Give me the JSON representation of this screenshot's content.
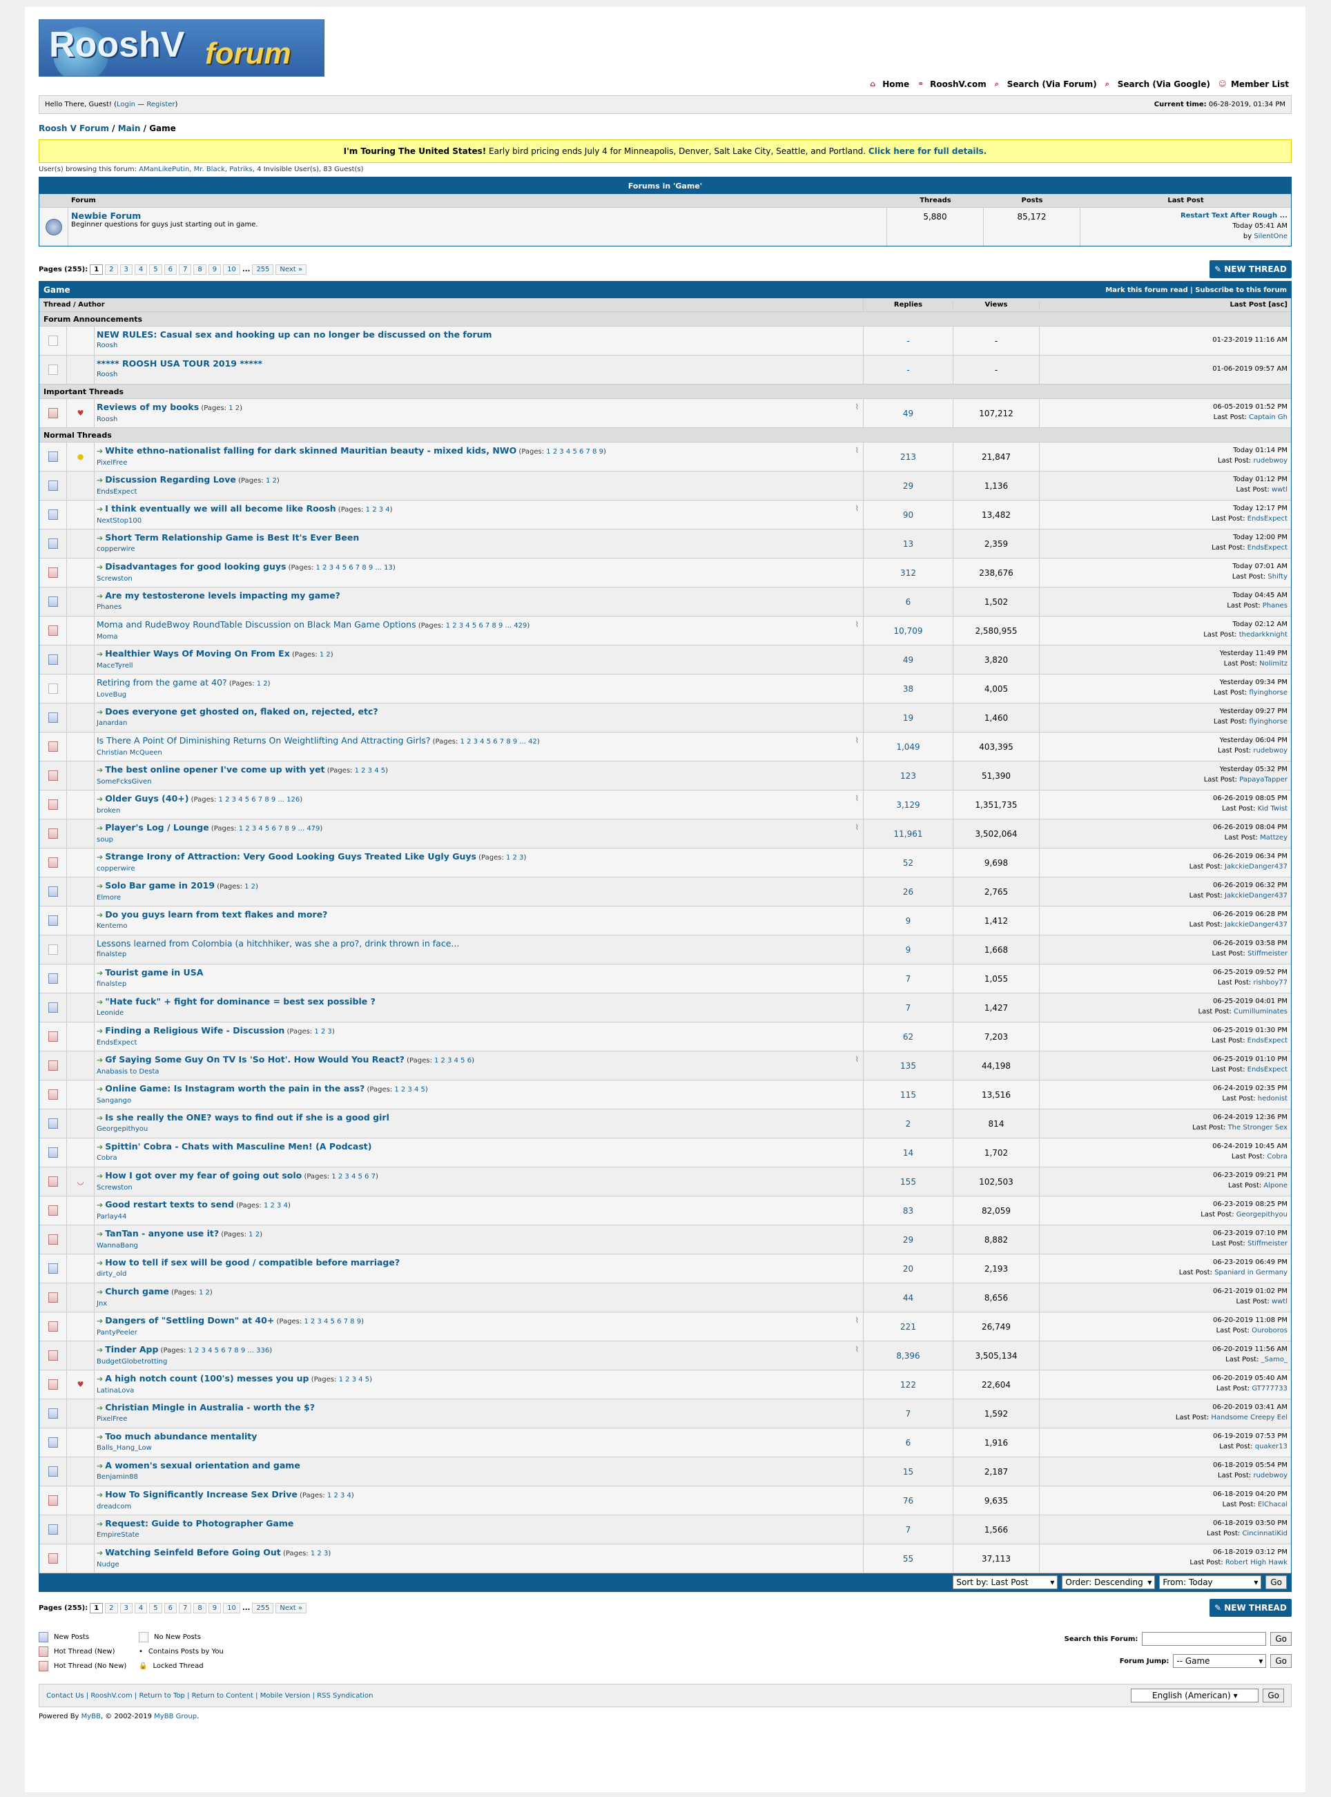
{
  "logo": {
    "text1": "RooshV",
    "text2": "forum"
  },
  "toplinks": [
    {
      "icon": "home-icon",
      "label": "Home"
    },
    {
      "icon": "link-icon",
      "label": "RooshV.com"
    },
    {
      "icon": "search-icon",
      "label": "Search (Via Forum)"
    },
    {
      "icon": "search-icon",
      "label": "Search (Via Google)"
    },
    {
      "icon": "members-icon",
      "label": "Member List"
    }
  ],
  "welcome": {
    "prefix": "Hello There, Guest! (",
    "login": "Login",
    "sep": " — ",
    "register": "Register",
    "suffix": ")",
    "time_label": "Current time:",
    "time": "06-28-2019, 01:34 PM"
  },
  "breadcrumb": [
    "Roosh V Forum",
    "Main",
    "Game"
  ],
  "banner": {
    "bold": "I'm Touring The United States!",
    "text": " Early bird pricing ends July 4 for Minneapolis, Denver, Salt Lake City, Seattle, and Portland. ",
    "link": "Click here for full details."
  },
  "browsing": {
    "prefix": "User(s) browsing this forum: ",
    "users": "AManLikePutin, Mr. Black, Patriks",
    "suffix": ", 4 Invisible User(s), 83 Guest(s)"
  },
  "subforums": {
    "title": "Forums in 'Game'",
    "headers": [
      "Forum",
      "Threads",
      "Posts",
      "Last Post"
    ],
    "rows": [
      {
        "name": "Newbie Forum",
        "desc": "Beginner questions for guys just starting out in game.",
        "threads": "5,880",
        "posts": "85,172",
        "last_title": "Restart Text After Rough ...",
        "last_time": "Today 05:41 AM",
        "last_by_prefix": "by ",
        "last_by": "SilentOne"
      }
    ]
  },
  "pagination": {
    "label": "Pages (255):",
    "pages": [
      "1",
      "2",
      "3",
      "4",
      "5",
      "6",
      "7",
      "8",
      "9",
      "10"
    ],
    "ellipsis": "...",
    "last": "255",
    "next": "Next »"
  },
  "new_thread_label": "NEW THREAD",
  "threadlist": {
    "title": "Game",
    "actions": "Mark this forum read | Subscribe to this forum",
    "headers": {
      "thread": "Thread / Author",
      "replies": "Replies",
      "views": "Views",
      "lastpost": "Last Post [asc]"
    },
    "sections": {
      "announcements": "Forum Announcements",
      "important": "Important Threads",
      "normal": "Normal Threads"
    },
    "lastpost_prefix": "Last Post: ",
    "pages_prefix": "(Pages: ",
    "pages_suffix": ")"
  },
  "announcements": [
    {
      "title": "NEW RULES: Casual sex and hooking up can no longer be discussed on the forum",
      "author": "Roosh",
      "replies": "-",
      "views": "-",
      "time": "01-23-2019 11:16 AM"
    },
    {
      "title": "***** ROOSH USA TOUR 2019 *****",
      "author": "Roosh",
      "replies": "-",
      "views": "-",
      "time": "01-06-2019 09:57 AM"
    }
  ],
  "important": [
    {
      "title": "Reviews of my books",
      "pages": "1 2",
      "author": "Roosh",
      "replies": "49",
      "views": "107,212",
      "time": "06-05-2019 01:52 PM",
      "lastby": "Captain Gh",
      "icon": "heart-icon",
      "clip": true,
      "fold": "hot"
    }
  ],
  "threads": [
    {
      "title": "White ethno-nationalist falling for dark skinned Mauritian beauty - mixed kids, NWO",
      "pages": "1 2 3 4 5 6 7 8 9",
      "author": "PixelFree",
      "replies": "213",
      "views": "21,847",
      "time": "Today 01:14 PM",
      "lastby": "rudebwoy",
      "icon": "lightbulb-icon",
      "clip": true,
      "fold": "new",
      "arrow": true
    },
    {
      "title": "Discussion Regarding Love",
      "pages": "1 2",
      "author": "EndsExpect",
      "replies": "29",
      "views": "1,136",
      "time": "Today 01:12 PM",
      "lastby": "wwtl",
      "fold": "new",
      "arrow": true
    },
    {
      "title": "I think eventually we will all become like Roosh",
      "pages": "1 2 3 4",
      "author": "NextStop100",
      "replies": "90",
      "views": "13,482",
      "time": "Today 12:17 PM",
      "lastby": "EndsExpect",
      "clip": true,
      "fold": "new",
      "arrow": true
    },
    {
      "title": "Short Term Relationship Game is Best It's Ever Been",
      "author": "copperwire",
      "replies": "13",
      "views": "2,359",
      "time": "Today 12:00 PM",
      "lastby": "EndsExpect",
      "fold": "new",
      "arrow": true
    },
    {
      "title": "Disadvantages for good looking guys",
      "pages": "1 2 3 4 5 6 7 8 9 ... 13",
      "author": "Screwston",
      "replies": "312",
      "views": "238,676",
      "time": "Today 07:01 AM",
      "lastby": "Shifty",
      "fold": "hot",
      "arrow": true
    },
    {
      "title": "Are my testosterone levels impacting my game?",
      "author": "Phanes",
      "replies": "6",
      "views": "1,502",
      "time": "Today 04:45 AM",
      "lastby": "Phanes",
      "fold": "new",
      "arrow": true
    },
    {
      "title": "Moma and RudeBwoy RoundTable Discussion on Black Man Game Options",
      "pages": "1 2 3 4 5 6 7 8 9 ... 429",
      "author": "Moma",
      "replies": "10,709",
      "views": "2,580,955",
      "time": "Today 02:12 AM",
      "lastby": "thedarkknight",
      "clip": true,
      "fold": "hot",
      "read": true
    },
    {
      "title": "Healthier Ways Of Moving On From Ex",
      "pages": "1 2",
      "author": "MaceTyrell",
      "replies": "49",
      "views": "3,820",
      "time": "Yesterday 11:49 PM",
      "lastby": "Nolimitz",
      "fold": "new",
      "arrow": true
    },
    {
      "title": "Retiring from the game at 40?",
      "pages": "1 2",
      "author": "LoveBug",
      "replies": "38",
      "views": "4,005",
      "time": "Yesterday 09:34 PM",
      "lastby": "flyinghorse",
      "fold": "no",
      "read": true
    },
    {
      "title": "Does everyone get ghosted on, flaked on, rejected, etc?",
      "author": "Janardan",
      "replies": "19",
      "views": "1,460",
      "time": "Yesterday 09:27 PM",
      "lastby": "flyinghorse",
      "fold": "new",
      "arrow": true
    },
    {
      "title": "Is There A Point Of Diminishing Returns On Weightlifting And Attracting Girls?",
      "pages": "1 2 3 4 5 6 7 8 9 ... 42",
      "author": "Christian McQueen",
      "replies": "1,049",
      "views": "403,395",
      "time": "Yesterday 06:04 PM",
      "lastby": "rudebwoy",
      "clip": true,
      "fold": "hot",
      "read": true
    },
    {
      "title": "The best online opener I've come up with yet",
      "pages": "1 2 3 4 5",
      "author": "SomeFcksGiven",
      "replies": "123",
      "views": "51,390",
      "time": "Yesterday 05:32 PM",
      "lastby": "PapayaTapper",
      "fold": "hot",
      "arrow": true
    },
    {
      "title": "Older Guys (40+)",
      "pages": "1 2 3 4 5 6 7 8 9 ... 126",
      "author": "broken",
      "replies": "3,129",
      "views": "1,351,735",
      "time": "06-26-2019 08:05 PM",
      "lastby": "Kid Twist",
      "clip": true,
      "fold": "hot",
      "arrow": true
    },
    {
      "title": "Player's Log / Lounge",
      "pages": "1 2 3 4 5 6 7 8 9 ... 479",
      "author": "soup",
      "replies": "11,961",
      "views": "3,502,064",
      "time": "06-26-2019 08:04 PM",
      "lastby": "Mattzey",
      "clip": true,
      "fold": "hot",
      "arrow": true
    },
    {
      "title": "Strange Irony of Attraction: Very Good Looking Guys Treated Like Ugly Guys",
      "pages": "1 2 3",
      "author": "copperwire",
      "replies": "52",
      "views": "9,698",
      "time": "06-26-2019 06:34 PM",
      "lastby": "JakckieDanger437",
      "fold": "hot",
      "arrow": true
    },
    {
      "title": "Solo Bar game in 2019",
      "pages": "1 2",
      "author": "Elmore",
      "replies": "26",
      "views": "2,765",
      "time": "06-26-2019 06:32 PM",
      "lastby": "JakckieDanger437",
      "fold": "new",
      "arrow": true
    },
    {
      "title": "Do you guys learn from text flakes and more?",
      "author": "Kentemo",
      "replies": "9",
      "views": "1,412",
      "time": "06-26-2019 06:28 PM",
      "lastby": "JakckieDanger437",
      "fold": "new",
      "arrow": true
    },
    {
      "title": "Lessons learned from Colombia (a hitchhiker, was she a pro?, drink thrown in face...",
      "author": "finalstep",
      "replies": "9",
      "views": "1,668",
      "time": "06-26-2019 03:58 PM",
      "lastby": "Stiffmeister",
      "fold": "no",
      "read": true
    },
    {
      "title": "Tourist game in USA",
      "author": "finalstep",
      "replies": "7",
      "views": "1,055",
      "time": "06-25-2019 09:52 PM",
      "lastby": "rishboy77",
      "fold": "new",
      "arrow": true
    },
    {
      "title": "\"Hate fuck\" + fight for dominance = best sex possible ?",
      "author": "Leonide",
      "replies": "7",
      "views": "1,427",
      "time": "06-25-2019 04:01 PM",
      "lastby": "Cumilluminates",
      "fold": "new",
      "arrow": true
    },
    {
      "title": "Finding a Religious Wife - Discussion",
      "pages": "1 2 3",
      "author": "EndsExpect",
      "replies": "62",
      "views": "7,203",
      "time": "06-25-2019 01:30 PM",
      "lastby": "EndsExpect",
      "fold": "hot",
      "arrow": true
    },
    {
      "title": "Gf Saying Some Guy On TV Is 'So Hot'. How Would You React?",
      "pages": "1 2 3 4 5 6",
      "author": "Anabasis to Desta",
      "replies": "135",
      "views": "44,198",
      "time": "06-25-2019 01:10 PM",
      "lastby": "EndsExpect",
      "clip": true,
      "fold": "hot",
      "arrow": true
    },
    {
      "title": "Online Game: Is Instagram worth the pain in the ass?",
      "pages": "1 2 3 4 5",
      "author": "Sangango",
      "replies": "115",
      "views": "13,516",
      "time": "06-24-2019 02:35 PM",
      "lastby": "hedonist",
      "fold": "hot",
      "arrow": true
    },
    {
      "title": "Is she really the ONE? ways to find out if she is a good girl",
      "author": "Georgepithyou",
      "replies": "2",
      "views": "814",
      "time": "06-24-2019 12:36 PM",
      "lastby": "The Stronger Sex",
      "fold": "new",
      "arrow": true
    },
    {
      "title": "Spittin' Cobra - Chats with Masculine Men! (A Podcast)",
      "author": "Cobra",
      "replies": "14",
      "views": "1,702",
      "time": "06-24-2019 10:45 AM",
      "lastby": "Cobra",
      "fold": "new",
      "arrow": true
    },
    {
      "title": "How I got over my fear of going out solo",
      "pages": "1 2 3 4 5 6 7",
      "author": "Screwston",
      "replies": "155",
      "views": "102,503",
      "time": "06-23-2019 09:21 PM",
      "lastby": "Alpone",
      "icon": "smile-icon",
      "fold": "hot",
      "arrow": true
    },
    {
      "title": "Good restart texts to send",
      "pages": "1 2 3 4",
      "author": "Parlay44",
      "replies": "83",
      "views": "82,059",
      "time": "06-23-2019 08:25 PM",
      "lastby": "Georgepithyou",
      "fold": "hot",
      "arrow": true
    },
    {
      "title": "TanTan - anyone use it?",
      "pages": "1 2",
      "author": "WannaBang",
      "replies": "29",
      "views": "8,882",
      "time": "06-23-2019 07:10 PM",
      "lastby": "Stiffmeister",
      "fold": "hot",
      "arrow": true
    },
    {
      "title": "How to tell if sex will be good / compatible before marriage?",
      "author": "dirty_old",
      "replies": "20",
      "views": "2,193",
      "time": "06-23-2019 06:49 PM",
      "lastby": "Spaniard in Germany",
      "fold": "new",
      "arrow": true
    },
    {
      "title": "Church game",
      "pages": "1 2",
      "author": "Jnx",
      "replies": "44",
      "views": "8,656",
      "time": "06-21-2019 01:02 PM",
      "lastby": "wwtl",
      "fold": "hot",
      "arrow": true
    },
    {
      "title": "Dangers of \"Settling Down\" at 40+",
      "pages": "1 2 3 4 5 6 7 8 9",
      "author": "PantyPeeler",
      "replies": "221",
      "views": "26,749",
      "time": "06-20-2019 11:08 PM",
      "lastby": "Ouroboros",
      "clip": true,
      "fold": "hot",
      "arrow": true
    },
    {
      "title": "Tinder App",
      "pages": "1 2 3 4 5 6 7 8 9 ... 336",
      "author": "BudgetGlobetrotting",
      "replies": "8,396",
      "views": "3,505,134",
      "time": "06-20-2019 11:56 AM",
      "lastby": "_Samo_",
      "clip": true,
      "fold": "hot",
      "arrow": true
    },
    {
      "title": "A high notch count (100's) messes you up",
      "pages": "1 2 3 4 5",
      "author": "LatinaLova",
      "replies": "122",
      "views": "22,604",
      "time": "06-20-2019 05:40 AM",
      "lastby": "GT777733",
      "icon": "heart-icon",
      "fold": "hot",
      "arrow": true
    },
    {
      "title": "Christian Mingle in Australia - worth the $?",
      "author": "PixelFree",
      "replies": "7",
      "views": "1,592",
      "time": "06-20-2019 03:41 AM",
      "lastby": "Handsome Creepy Eel",
      "fold": "new",
      "arrow": true
    },
    {
      "title": "Too much abundance mentality",
      "author": "Balls_Hang_Low",
      "replies": "6",
      "views": "1,916",
      "time": "06-19-2019 07:53 PM",
      "lastby": "quaker13",
      "fold": "new",
      "arrow": true
    },
    {
      "title": "A women's sexual orientation and game",
      "author": "Benjamin88",
      "replies": "15",
      "views": "2,187",
      "time": "06-18-2019 05:54 PM",
      "lastby": "rudebwoy",
      "fold": "new",
      "arrow": true
    },
    {
      "title": "How To Significantly Increase Sex Drive",
      "pages": "1 2 3 4",
      "author": "dreadcom",
      "replies": "76",
      "views": "9,635",
      "time": "06-18-2019 04:20 PM",
      "lastby": "ElChacal",
      "fold": "hot",
      "arrow": true
    },
    {
      "title": "Request: Guide to Photographer Game",
      "author": "EmpireState",
      "replies": "7",
      "views": "1,566",
      "time": "06-18-2019 03:50 PM",
      "lastby": "CincinnatiKid",
      "fold": "new",
      "arrow": true
    },
    {
      "title": "Watching Seinfeld Before Going Out",
      "pages": "1 2 3",
      "author": "Nudge",
      "replies": "55",
      "views": "37,113",
      "time": "06-18-2019 03:12 PM",
      "lastby": "Robert High Hawk",
      "fold": "hot",
      "arrow": true
    }
  ],
  "sortbar": {
    "sort": "Sort by: Last Post",
    "order": "Order: Descending",
    "from": "From: Today",
    "go": "Go"
  },
  "legend": [
    {
      "label": "New Posts",
      "icon": "new-posts-icon"
    },
    {
      "label": "No New Posts",
      "icon": "no-new-posts-icon"
    },
    {
      "label": "Hot Thread (New)",
      "icon": "hot-thread-new-icon"
    },
    {
      "label": "Contains Posts by You",
      "icon": "dot-icon"
    },
    {
      "label": "Hot Thread (No New)",
      "icon": "hot-thread-icon"
    },
    {
      "label": "Locked Thread",
      "icon": "lock-icon"
    }
  ],
  "search_forum": {
    "label": "Search this Forum:",
    "go": "Go"
  },
  "jump": {
    "label": "Forum Jump:",
    "value": "-- Game",
    "go": "Go"
  },
  "footer_links": "Contact Us | RooshV.com | Return to Top | Return to Content | Mobile Version | RSS Syndication",
  "language": {
    "value": "English (American)",
    "go": "Go"
  },
  "powered": {
    "prefix": "Powered By ",
    "mybb": "MyBB",
    "mid": ", © 2002-2019 ",
    "group": "MyBB Group",
    "end": "."
  },
  "colors": {
    "accent": "#0f5c8e",
    "banner": "#ffff99"
  }
}
